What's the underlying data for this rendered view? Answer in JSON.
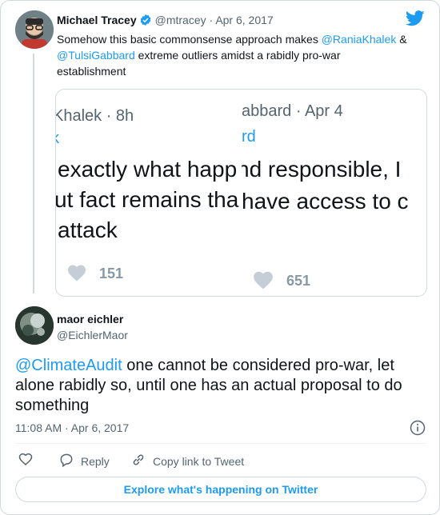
{
  "parent_tweet": {
    "author_name": "Michael Tracey",
    "author_handle": "@mtracey",
    "separator": "·",
    "date": "Apr 6, 2017",
    "text_before": "Somehow this basic commonsense approach makes ",
    "mention_1": "@RaniaKhalek",
    "text_middle": " & ",
    "mention_2": "@TulsiGabbard",
    "text_after": " extreme outliers amidst a rabidly pro-war establishment"
  },
  "quoted_image": {
    "left_panel": {
      "meta": "Khalek · 8h",
      "handle": "k",
      "line_1": "exactly what happ",
      "line_2": "ut fact remains tha",
      "line_3": "attack",
      "likes": "151"
    },
    "right_panel": {
      "meta": "abbard · Apr 4",
      "handle": "rd",
      "line_1": "nd responsible, I",
      "line_2": "have access to c",
      "likes": "651"
    }
  },
  "reply_tweet": {
    "author_name": "maor eichler",
    "author_handle": "@EichlerMaor",
    "mention": "@ClimateAudit",
    "text": " one cannot be considered pro-war, let alone rabidly so, until one has an actual proposal to do something",
    "timestamp": "11:08 AM · Apr 6, 2017"
  },
  "actions": {
    "reply_label": "Reply",
    "copy_link_label": "Copy link to Tweet"
  },
  "explore_button_label": "Explore what's happening on Twitter",
  "colors": {
    "accent": "#1d9bf0",
    "text": "#0f1419",
    "secondary": "#536471",
    "border": "#cfd9de"
  },
  "icons": [
    "twitter-bird-icon",
    "verified-badge-icon",
    "heart-icon",
    "reply-icon",
    "link-icon",
    "info-icon"
  ]
}
